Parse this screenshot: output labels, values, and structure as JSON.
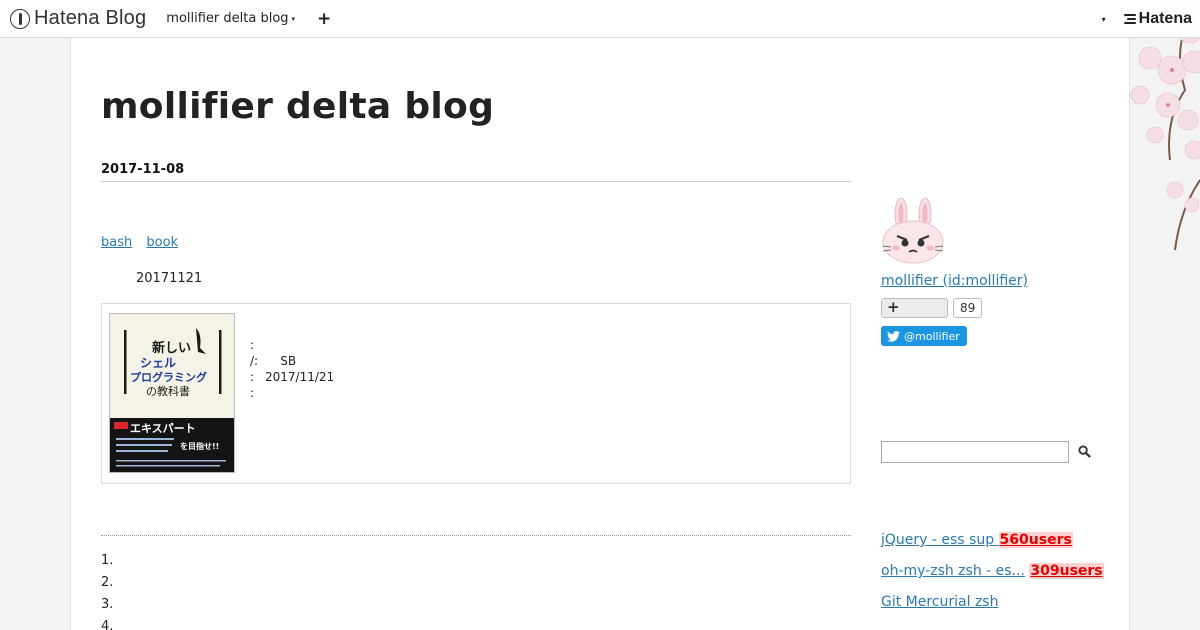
{
  "header": {
    "logo_text": "Hatena Blog",
    "blog_name": "mollifier delta blog",
    "caret": "▾",
    "plus": "+",
    "user_caret": "▾",
    "hatena_text": "Hatena"
  },
  "blog": {
    "title": "mollifier delta blog"
  },
  "entry": {
    "date": "2017-11-08",
    "categories": [
      "bash",
      "book"
    ],
    "release": "20171121",
    "book_cover_lines": [
      "新しい",
      "シェル",
      "プログラミング",
      "の教科書",
      "エキスパート",
      "を目指せ!!"
    ],
    "meta": [
      {
        "k": ":",
        "v": ""
      },
      {
        "k": "/:",
        "v": "SB"
      },
      {
        "k": ":",
        "v": "2017/11/21"
      },
      {
        "k": ":",
        "v": ""
      }
    ],
    "list": [
      "1.",
      "2.",
      "3.",
      "4."
    ]
  },
  "sidebar": {
    "profile_name": "mollifier (id:mollifier)",
    "follow_icon": "+",
    "follow_count": "89",
    "twitter_label": "@mollifier",
    "search_placeholder": "",
    "hot_entries": [
      {
        "title": "jQuery  - ess sup ",
        "users": "560users"
      },
      {
        "title": "oh-my-zsh  zsh  - es...",
        "users": "309users"
      },
      {
        "title": "Git  Mercurial zsh",
        "users": ""
      }
    ]
  },
  "colors": {
    "link": "#2a7ab0",
    "users_red": "#e50000",
    "twitter": "#1b95e0"
  }
}
